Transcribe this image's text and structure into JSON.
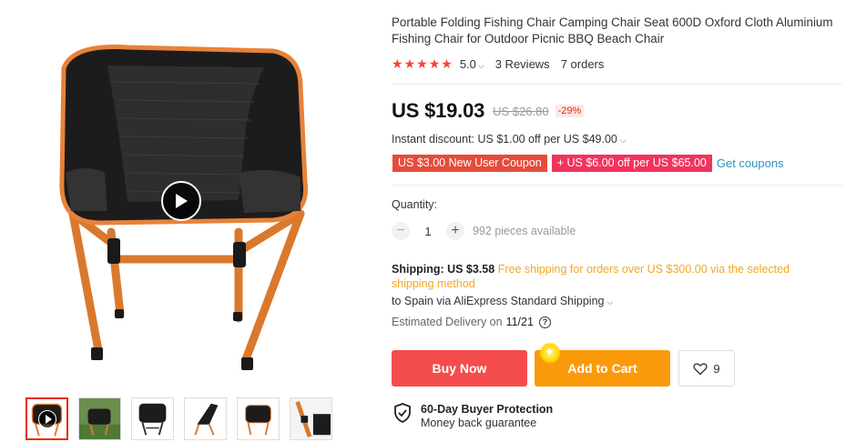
{
  "product": {
    "title": "Portable Folding Fishing Chair Camping Chair Seat 600D Oxford Cloth Aluminium Fishing Chair for Outdoor Picnic BBQ Beach Chair",
    "rating": "5.0",
    "reviews": "3 Reviews",
    "orders": "7 orders",
    "stars": 5
  },
  "price": {
    "current": "US $19.03",
    "original": "US $26.80",
    "discount": "-29%"
  },
  "instant_discount": "Instant discount: US $1.00 off per US $49.00",
  "coupons": {
    "new_user": "US $3.00 New User Coupon",
    "store": "+ US $6.00 off per US $65.00",
    "get": "Get coupons"
  },
  "quantity": {
    "label": "Quantity:",
    "minus": "−",
    "value": "1",
    "plus": "+",
    "available": "992 pieces available"
  },
  "shipping": {
    "label": "Shipping: US $3.58",
    "free_note": "Free shipping for orders over US $300.00 via the selected shipping method",
    "destination": "to Spain via AliExpress Standard Shipping",
    "delivery_label": "Estimated Delivery on",
    "delivery_date": "11/21"
  },
  "actions": {
    "buy": "Buy Now",
    "cart": "Add to Cart",
    "wishlist_count": "9"
  },
  "protection": {
    "title": "60-Day Buyer Protection",
    "subtitle": "Money back guarantee"
  },
  "gallery": {
    "thumbnails": [
      "chair-front-video",
      "chair-outdoor-grass",
      "chair-black-front",
      "chair-side-view",
      "chair-front-white",
      "chair-detail-closeup"
    ],
    "active_index": 0
  },
  "colors": {
    "accent_red": "#f44c4c",
    "cart_orange": "#fa9a0a",
    "star_red": "#f44336",
    "free_shipping": "#f5a623",
    "coupon_red": "#e54c3c",
    "coupon_pink": "#f2335d",
    "link_blue": "#2b95b8",
    "chair_frame": "#e8823a"
  }
}
